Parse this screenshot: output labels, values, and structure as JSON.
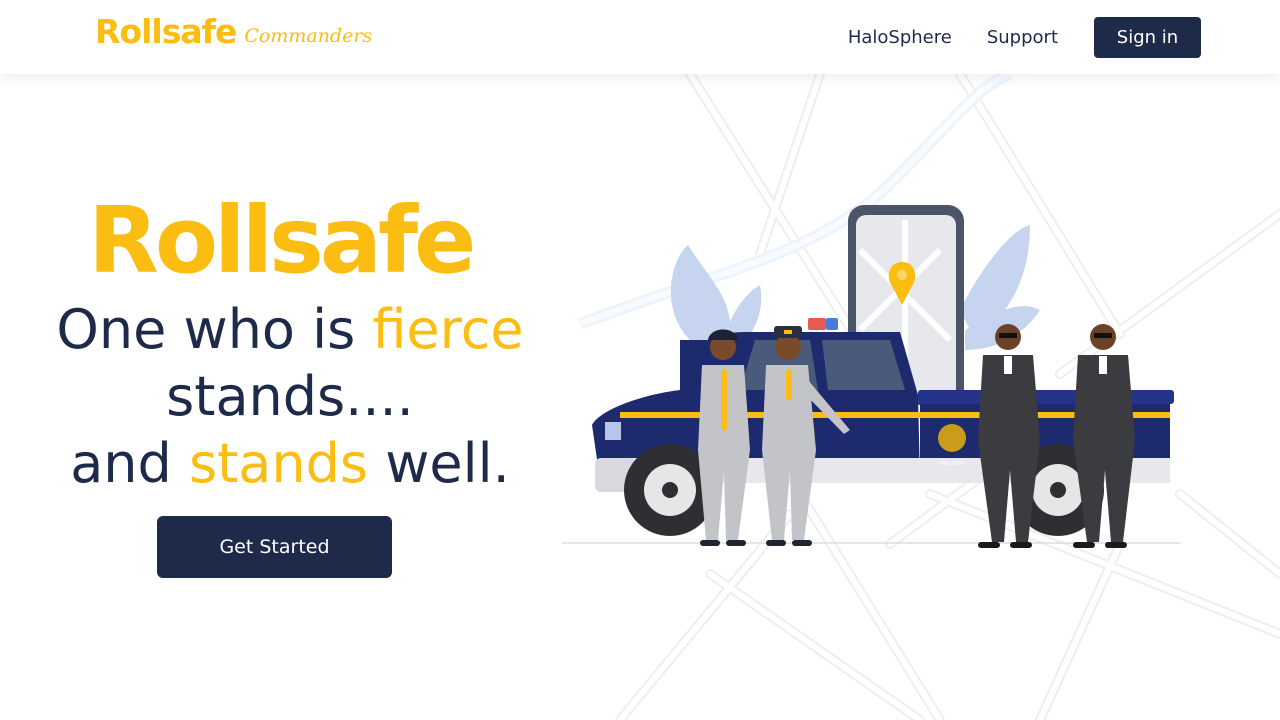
{
  "header": {
    "brand_name": "Rollsafe",
    "brand_sub": "Commanders",
    "nav": [
      {
        "label": "HaloSphere"
      },
      {
        "label": "Support"
      }
    ],
    "signin_label": "Sign in"
  },
  "hero": {
    "logo_text": "Rollsafe",
    "tagline": {
      "line1_a": "One who is ",
      "line1_b": "fierce",
      "line2": "stands....",
      "line3_a": "and ",
      "line3_b": "stands",
      "line3_c": " well."
    },
    "cta_label": "Get Started"
  },
  "illustration": {
    "truck_emblem_text": "HALOGEN",
    "subject": "security-guards-with-pickup-truck"
  },
  "colors": {
    "accent": "#fbbd12",
    "navy": "#1e2a4a",
    "background": "#ffffff"
  }
}
